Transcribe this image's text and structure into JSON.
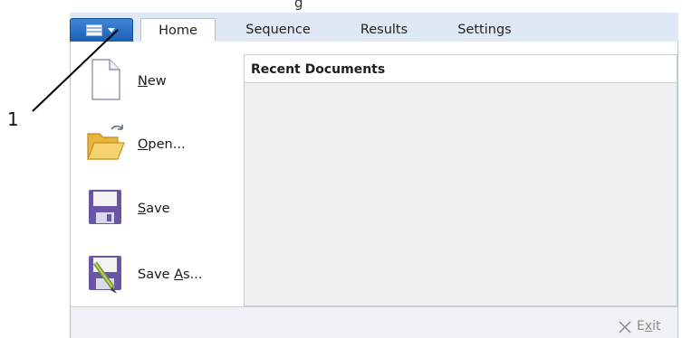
{
  "window": {
    "title_fragment": "g"
  },
  "ribbon": {
    "app_button_icon": "document-dropdown-icon",
    "tabs": [
      {
        "label": "Home",
        "active": true
      },
      {
        "label": "Sequence",
        "active": false
      },
      {
        "label": "Results",
        "active": false
      },
      {
        "label": "Settings",
        "active": false
      }
    ]
  },
  "file_menu": {
    "items": [
      {
        "label_prefix": "",
        "label_mnemonic": "N",
        "label_rest": "ew",
        "icon": "new-document-icon"
      },
      {
        "label_prefix": "",
        "label_mnemonic": "O",
        "label_rest": "pen...",
        "icon": "open-folder-icon"
      },
      {
        "label_prefix": "",
        "label_mnemonic": "S",
        "label_rest": "ave",
        "icon": "save-disk-icon"
      },
      {
        "label_prefix": "Save ",
        "label_mnemonic": "A",
        "label_rest": "s...",
        "icon": "save-as-icon"
      }
    ],
    "recent_documents_title": "Recent Documents"
  },
  "footer": {
    "exit_prefix": "E",
    "exit_mnemonic": "x",
    "exit_rest": "it",
    "exit_icon": "close-x-icon"
  },
  "annotation": {
    "callout_number": "1"
  },
  "colors": {
    "app_button": "#2a6fc8",
    "tabstrip": "#dfe9f5",
    "recent_bg": "#f0f0f0",
    "folder": "#f3c24f",
    "save_disk": "#6b55a8"
  }
}
